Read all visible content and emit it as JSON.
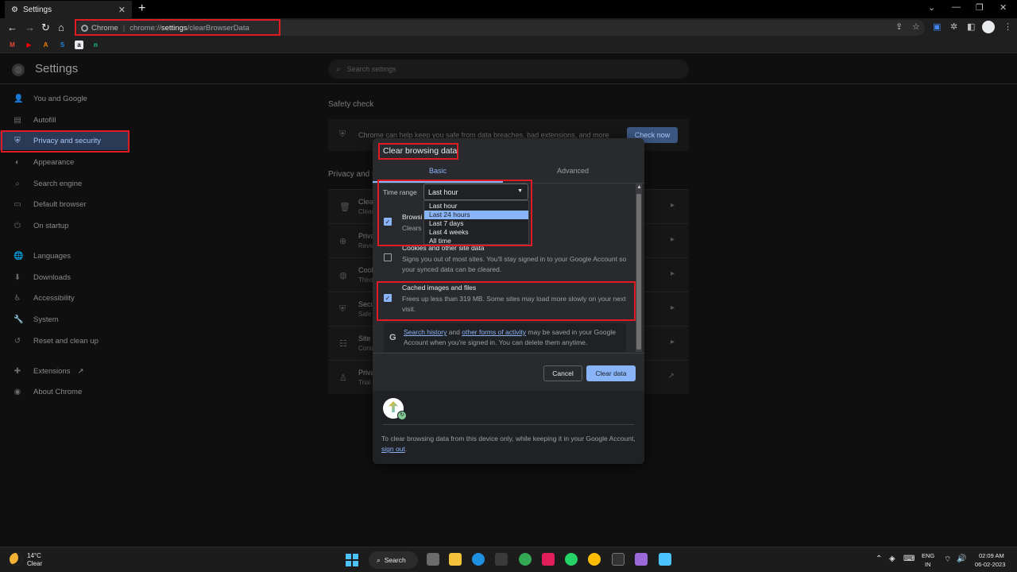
{
  "browser": {
    "tab_title": "Settings",
    "tab_close": "✕",
    "new_tab": "+",
    "window_controls": [
      "⌄",
      "—",
      "❐",
      "✕"
    ],
    "omnibox": {
      "chip": "Chrome",
      "scheme": "chrome://",
      "host": "settings",
      "path": "/clearBrowserData"
    },
    "bookmarks": [
      {
        "icon": "gmail-icon",
        "label": "M",
        "color": "#ea4335"
      },
      {
        "icon": "youtube-icon",
        "label": "▶",
        "color": "#ff0000"
      },
      {
        "icon": "arc-icon",
        "label": "A",
        "color": "#f57c00"
      },
      {
        "icon": "stackoverflow-icon",
        "label": "S",
        "color": "#1e88e5"
      },
      {
        "icon": "amazon-icon",
        "label": "a",
        "color": "#e8eaed"
      },
      {
        "icon": "grammarly-icon",
        "label": "n",
        "color": "#15c39a"
      }
    ]
  },
  "settings": {
    "title": "Settings",
    "search_placeholder": "Search settings",
    "sidebar": [
      {
        "icon": "👤",
        "label": "You and Google"
      },
      {
        "icon": "▤",
        "label": "Autofill"
      },
      {
        "icon": "⛨",
        "label": "Privacy and security",
        "active": true
      },
      {
        "icon": "◐",
        "label": "Appearance"
      },
      {
        "icon": "⌕",
        "label": "Search engine"
      },
      {
        "icon": "▭",
        "label": "Default browser"
      },
      {
        "icon": "⏻",
        "label": "On startup"
      },
      {
        "icon": "🌐",
        "label": "Languages"
      },
      {
        "icon": "⬇",
        "label": "Downloads"
      },
      {
        "icon": "♿",
        "label": "Accessibility"
      },
      {
        "icon": "🔧",
        "label": "System"
      },
      {
        "icon": "↺",
        "label": "Reset and clean up"
      },
      {
        "icon": "✚",
        "label": "Extensions",
        "external": "↗"
      },
      {
        "icon": "◉",
        "label": "About Chrome"
      }
    ],
    "safety_check": {
      "heading": "Safety check",
      "text": "Chrome can help keep you safe from data breaches, bad extensions, and more",
      "button": "Check now"
    },
    "privacy_heading": "Privacy and s",
    "privacy_rows": [
      {
        "icon": "🗑",
        "title": "Clear",
        "sub": "Clear"
      },
      {
        "icon": "⊕",
        "title": "Priva",
        "sub": "Revie"
      },
      {
        "icon": "◍",
        "title": "Cook",
        "sub": "Third"
      },
      {
        "icon": "⛨",
        "title": "Secu",
        "sub": "Safe"
      },
      {
        "icon": "☷",
        "title": "Site s",
        "sub": "Contr"
      },
      {
        "icon": "♙",
        "title": "Priva",
        "sub": "Trial"
      }
    ],
    "chevron": "▸",
    "external_chevron": "↗"
  },
  "dialog": {
    "title": "Clear browsing data",
    "tabs": [
      "Basic",
      "Advanced"
    ],
    "time_range_label": "Time range",
    "time_range_value": "Last hour",
    "time_range_options": [
      "Last hour",
      "Last 24 hours",
      "Last 7 days",
      "Last 4 weeks",
      "All time"
    ],
    "selected_option_index": 1,
    "items": [
      {
        "title": "Browsi",
        "desc": "Clears",
        "checked": true
      },
      {
        "title": "Cookies and other site data",
        "desc": "Signs you out of most sites. You'll stay signed in to your Google Account so your synced data can be cleared.",
        "checked": false
      },
      {
        "title": "Cached images and files",
        "desc": "Frees up less than 319 MB. Some sites may load more slowly on your next visit.",
        "checked": true
      }
    ],
    "info": {
      "link1": "Search history",
      "mid": " and ",
      "link2": "other forms of activity",
      "rest": " may be saved in your Google Account when you're signed in. You can delete them anytime."
    },
    "cancel": "Cancel",
    "clear": "Clear data",
    "footer_text": "To clear browsing data from this device only, while keeping it in your Google Account, ",
    "footer_link": "sign out",
    "footer_end": "."
  },
  "taskbar": {
    "weather_temp": "14°C",
    "weather_desc": "Clear",
    "search_label": "Search",
    "lang_line1": "ENG",
    "lang_line2": "IN",
    "time": "02:09 AM",
    "date": "06-02-2023"
  },
  "colors": {
    "accent": "#8ab4f8",
    "highlight": "#e01b24",
    "active_sidebar": "#2a3a55"
  }
}
